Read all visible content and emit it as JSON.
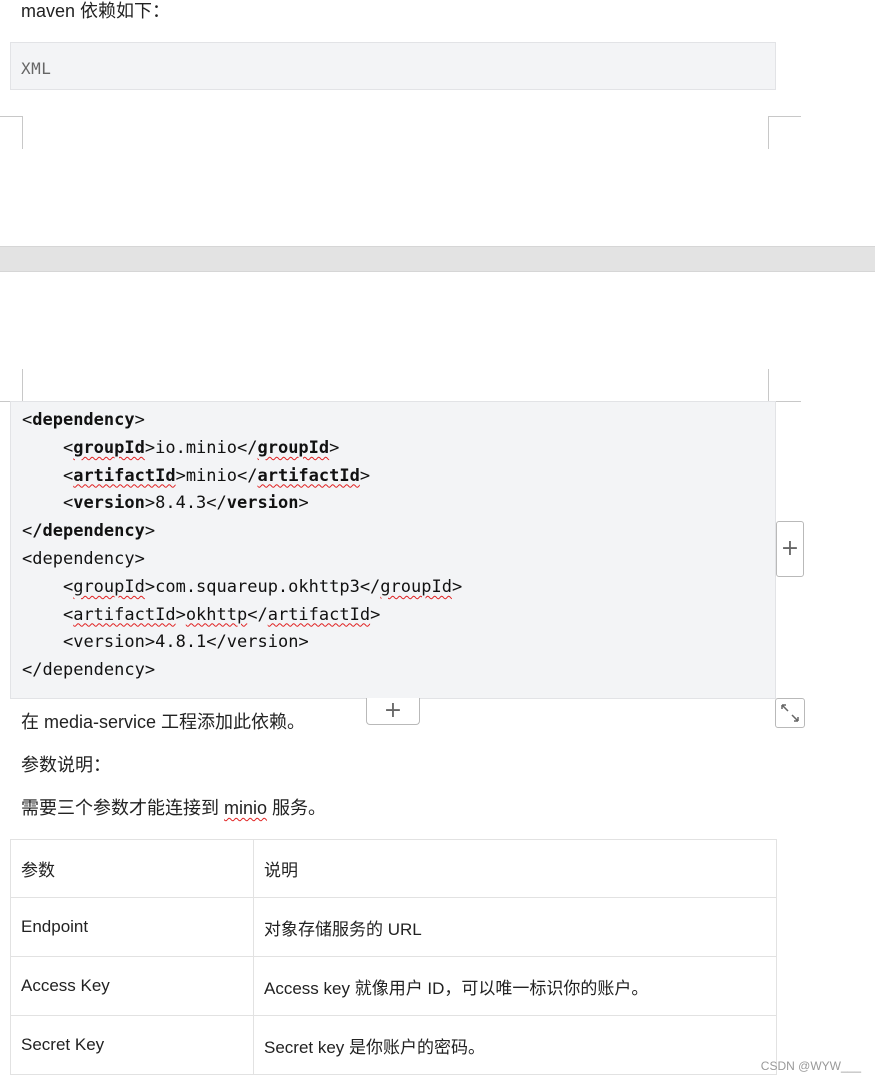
{
  "intro_text": "maven 依赖如下：",
  "code_language": "XML",
  "code_lines": [
    {
      "indent": "",
      "open": "<",
      "tag": "dependency",
      "close": ">",
      "text": ""
    },
    {
      "indent": "    ",
      "tag": "groupId",
      "text": "io.minio"
    },
    {
      "indent": "    ",
      "tag": "artifactId",
      "text": "minio"
    },
    {
      "indent": "    ",
      "tag": "version",
      "text": "8.4.3"
    },
    {
      "indent": "",
      "tag": "/dependency"
    },
    {
      "indent": "",
      "tag": "dependency"
    },
    {
      "indent": "    ",
      "tag": "groupId",
      "text": "com.squareup.okhttp3"
    },
    {
      "indent": "    ",
      "tag": "artifactId",
      "text": "okhttp"
    },
    {
      "indent": "    ",
      "tag": "version",
      "text": "4.8.1"
    },
    {
      "indent": "",
      "tag": "/dependency"
    }
  ],
  "project_note": "在 media-service 工程添加此依赖。",
  "params_heading": "参数说明：",
  "params_intro_prefix": "需要三个参数才能连接到 ",
  "params_intro_word": "minio",
  "params_intro_suffix": " 服务。",
  "table": {
    "headers": [
      "参数",
      "说明"
    ],
    "rows": [
      [
        "Endpoint",
        "对象存储服务的 URL"
      ],
      [
        "Access Key",
        "Access key 就像用户 ID，可以唯一标识你的账户。"
      ],
      [
        "Secret Key",
        "Secret key 是你账户的密码。"
      ]
    ]
  },
  "icons": {
    "add_row": "plus-icon",
    "add_column": "plus-icon",
    "resize": "expand-icon"
  },
  "watermark": "CSDN @WYW___"
}
